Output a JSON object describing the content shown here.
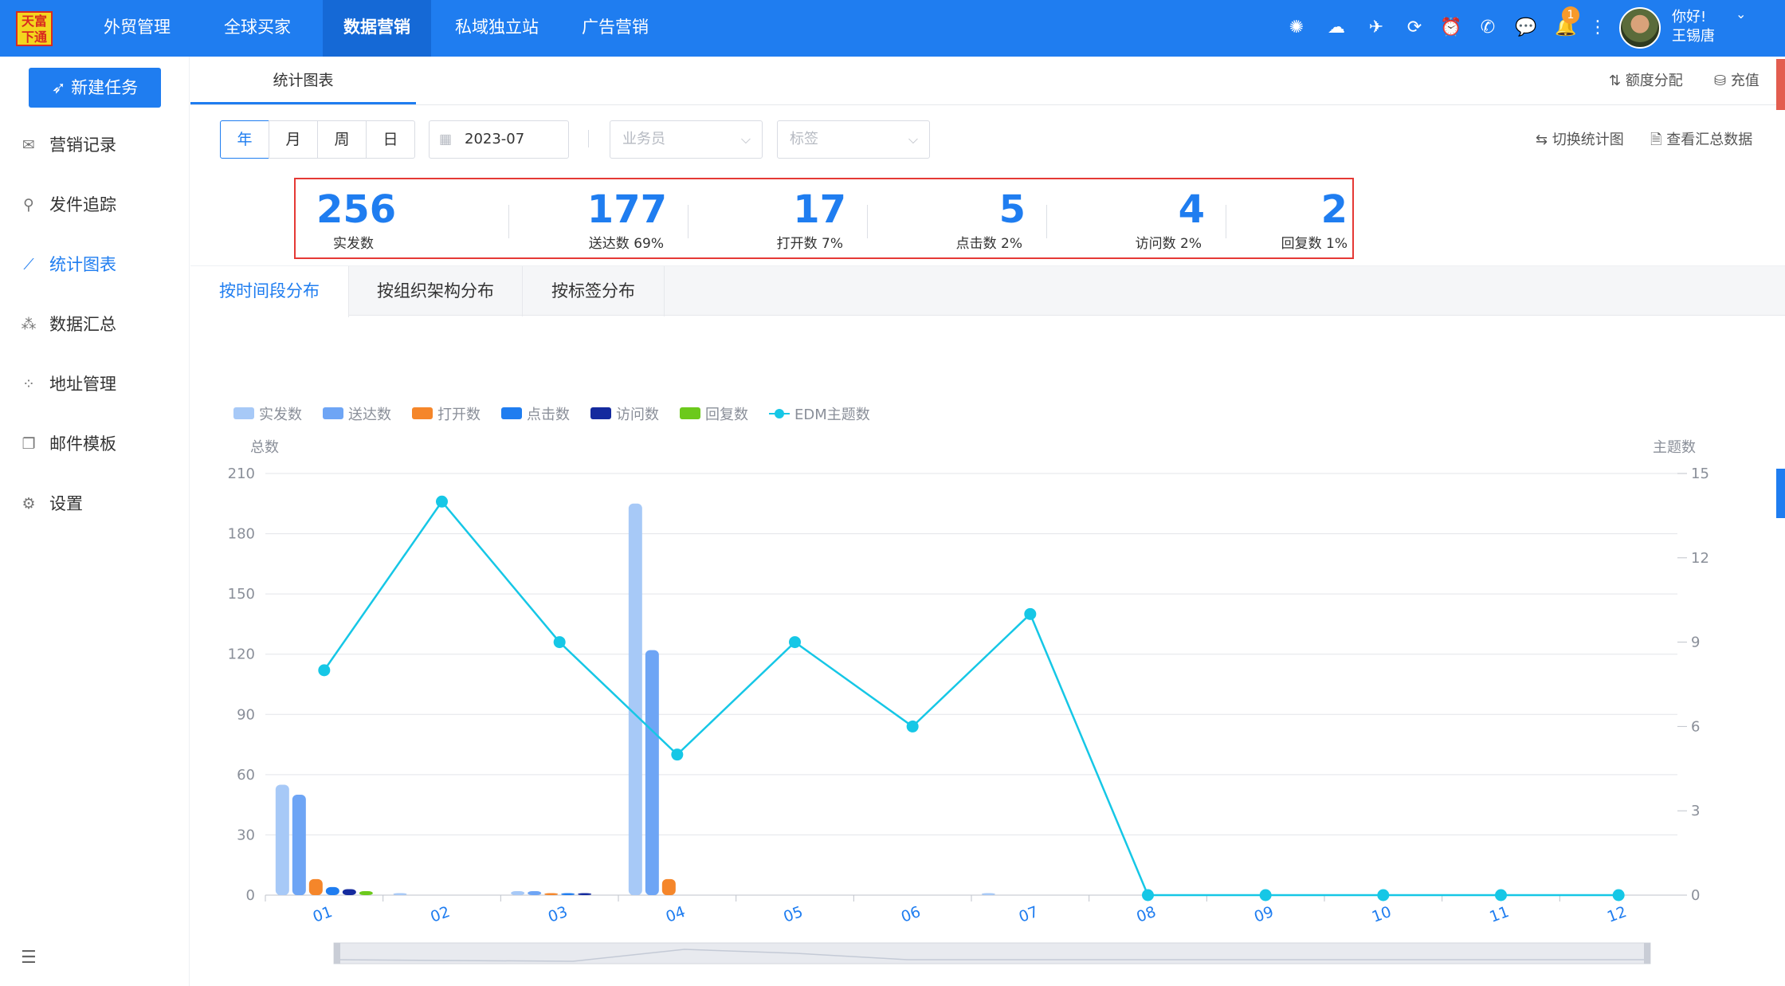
{
  "brand": {
    "logo_text_top": "天富",
    "logo_text_bottom": "下通"
  },
  "nav": [
    {
      "label": "外贸管理",
      "active": false
    },
    {
      "label": "全球买家",
      "active": false
    },
    {
      "label": "数据营销",
      "active": true
    },
    {
      "label": "私域独立站",
      "active": false
    },
    {
      "label": "广告营销",
      "active": false
    }
  ],
  "header": {
    "icons": [
      "openai-icon",
      "cloud-icon",
      "bird-icon",
      "play-icon",
      "alarm-icon",
      "whatsapp-icon",
      "chat-icon",
      "bell-icon",
      "more-icon"
    ],
    "notification_count": "1",
    "greeting": "你好!",
    "user_name": "王锡唐"
  },
  "sidebar": {
    "new_task": "新建任务",
    "items": [
      {
        "label": "营销记录",
        "icon": "mail-icon",
        "active": false
      },
      {
        "label": "发件追踪",
        "icon": "location-icon",
        "active": false
      },
      {
        "label": "统计图表",
        "icon": "line-chart-icon",
        "active": true
      },
      {
        "label": "数据汇总",
        "icon": "cluster-icon",
        "active": false
      },
      {
        "label": "地址管理",
        "icon": "grid-icon",
        "active": false
      },
      {
        "label": "邮件模板",
        "icon": "template-icon",
        "active": false
      },
      {
        "label": "设置",
        "icon": "settings-icon",
        "active": false
      }
    ]
  },
  "subtab": {
    "label": "统计图表"
  },
  "quota_link": "额度分配",
  "recharge_link": "充值",
  "filters": {
    "periods": [
      "年",
      "月",
      "周",
      "日"
    ],
    "active_period": "年",
    "date_value": "2023-07",
    "salesperson_placeholder": "业务员",
    "tag_placeholder": "标签",
    "switch_chart": "切换统计图",
    "view_summary": "查看汇总数据"
  },
  "stats": [
    {
      "value": "256",
      "label": "实发数"
    },
    {
      "value": "177",
      "label": "送达数 69%"
    },
    {
      "value": "17",
      "label": "打开数 7%"
    },
    {
      "value": "5",
      "label": "点击数 2%"
    },
    {
      "value": "4",
      "label": "访问数 2%"
    },
    {
      "value": "2",
      "label": "回复数 1%"
    }
  ],
  "dist_tabs": [
    {
      "label": "按时间段分布",
      "active": true
    },
    {
      "label": "按组织架构分布",
      "active": false
    },
    {
      "label": "按标签分布",
      "active": false
    }
  ],
  "chart_data": {
    "type": "bar",
    "categories": [
      "01",
      "02",
      "03",
      "04",
      "05",
      "06",
      "07",
      "08",
      "09",
      "10",
      "11",
      "12"
    ],
    "ylabel": "总数",
    "y2label": "主题数",
    "ylim": [
      0,
      210
    ],
    "y2lim": [
      0,
      15
    ],
    "yticks": [
      0,
      30,
      60,
      90,
      120,
      150,
      180,
      210
    ],
    "y2ticks": [
      0,
      3,
      6,
      9,
      12,
      15
    ],
    "grid": true,
    "legend_position": "top-left",
    "series": [
      {
        "name": "实发数",
        "kind": "bar",
        "color": "#a7c9f7",
        "values": [
          55,
          1,
          2,
          195,
          0,
          0,
          1,
          0,
          0,
          0,
          0,
          0
        ]
      },
      {
        "name": "送达数",
        "kind": "bar",
        "color": "#6ea5f5",
        "values": [
          50,
          0,
          2,
          122,
          0,
          0,
          0,
          0,
          0,
          0,
          0,
          0
        ]
      },
      {
        "name": "打开数",
        "kind": "bar",
        "color": "#f5862a",
        "values": [
          8,
          0,
          1,
          8,
          0,
          0,
          0,
          0,
          0,
          0,
          0,
          0
        ]
      },
      {
        "name": "点击数",
        "kind": "bar",
        "color": "#1f7df0",
        "values": [
          4,
          0,
          1,
          0,
          0,
          0,
          0,
          0,
          0,
          0,
          0,
          0
        ]
      },
      {
        "name": "访问数",
        "kind": "bar",
        "color": "#142a9e",
        "values": [
          3,
          0,
          1,
          0,
          0,
          0,
          0,
          0,
          0,
          0,
          0,
          0
        ]
      },
      {
        "name": "回复数",
        "kind": "bar",
        "color": "#6cc91c",
        "values": [
          2,
          0,
          0,
          0,
          0,
          0,
          0,
          0,
          0,
          0,
          0,
          0
        ]
      },
      {
        "name": "EDM主题数",
        "kind": "line",
        "axis": "right",
        "color": "#16c7e6",
        "values": [
          8,
          14,
          9,
          5,
          9,
          6,
          10,
          0,
          0,
          0,
          0,
          0
        ]
      }
    ]
  }
}
